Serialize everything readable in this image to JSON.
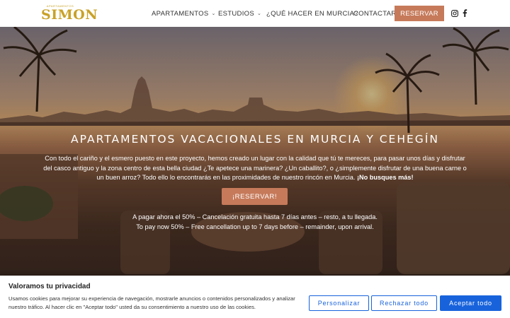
{
  "header": {
    "logo_small": "APARTAMENTOS",
    "logo_big": "SIMON",
    "nav": [
      {
        "label": "APARTAMENTOS",
        "has_dropdown": true
      },
      {
        "label": "ESTUDIOS",
        "has_dropdown": true
      },
      {
        "label": "¿QUÉ HACER EN MURCIA?",
        "has_dropdown": false
      },
      {
        "label": "CONTACTAR",
        "has_dropdown": false
      }
    ],
    "reserve_label": "RESERVAR",
    "social_icons": [
      "instagram-icon",
      "facebook-icon"
    ]
  },
  "hero": {
    "title": "APARTAMENTOS VACACIONALES EN MURCIA Y CEHEGÍN",
    "text": "Con todo el cariño y el esmero puesto en este proyecto, hemos creado un lugar con la calidad que tú te mereces, para pasar unos días y disfrutar del casco antiguo y la zona centro de esta bella ciudad ¿Te apetece una marinera? ¿Un caballito?, o ¿simplemente disfrutar de una buena carne o un buen arroz? Todo ello lo encontrarás en las proximidades de nuestro rincón en Murcia.",
    "text_bold": "¡No busques más!",
    "cta_label": "¡RESERVAR!",
    "note_es": "A pagar ahora el 50% – Cancelación gratuita hasta 7 días antes – resto, a tu llegada.",
    "note_en": "To pay now 50% – Free cancellation up to 7 days before – remainder, upon arrival."
  },
  "cookie": {
    "title": "Valoramos tu privacidad",
    "text": "Usamos cookies para mejorar su experiencia de navegación, mostrarle anuncios o contenidos personalizados y analizar nuestro tráfico. Al hacer clic en \"Aceptar todo\" usted da su consentimiento a nuestro uso de las cookies.",
    "customize_label": "Personalizar",
    "reject_label": "Rechazar todo",
    "accept_label": "Aceptar todo"
  },
  "colors": {
    "accent": "#c67a5a",
    "logo_gold": "#c9a227",
    "cookie_blue": "#1863dc"
  }
}
